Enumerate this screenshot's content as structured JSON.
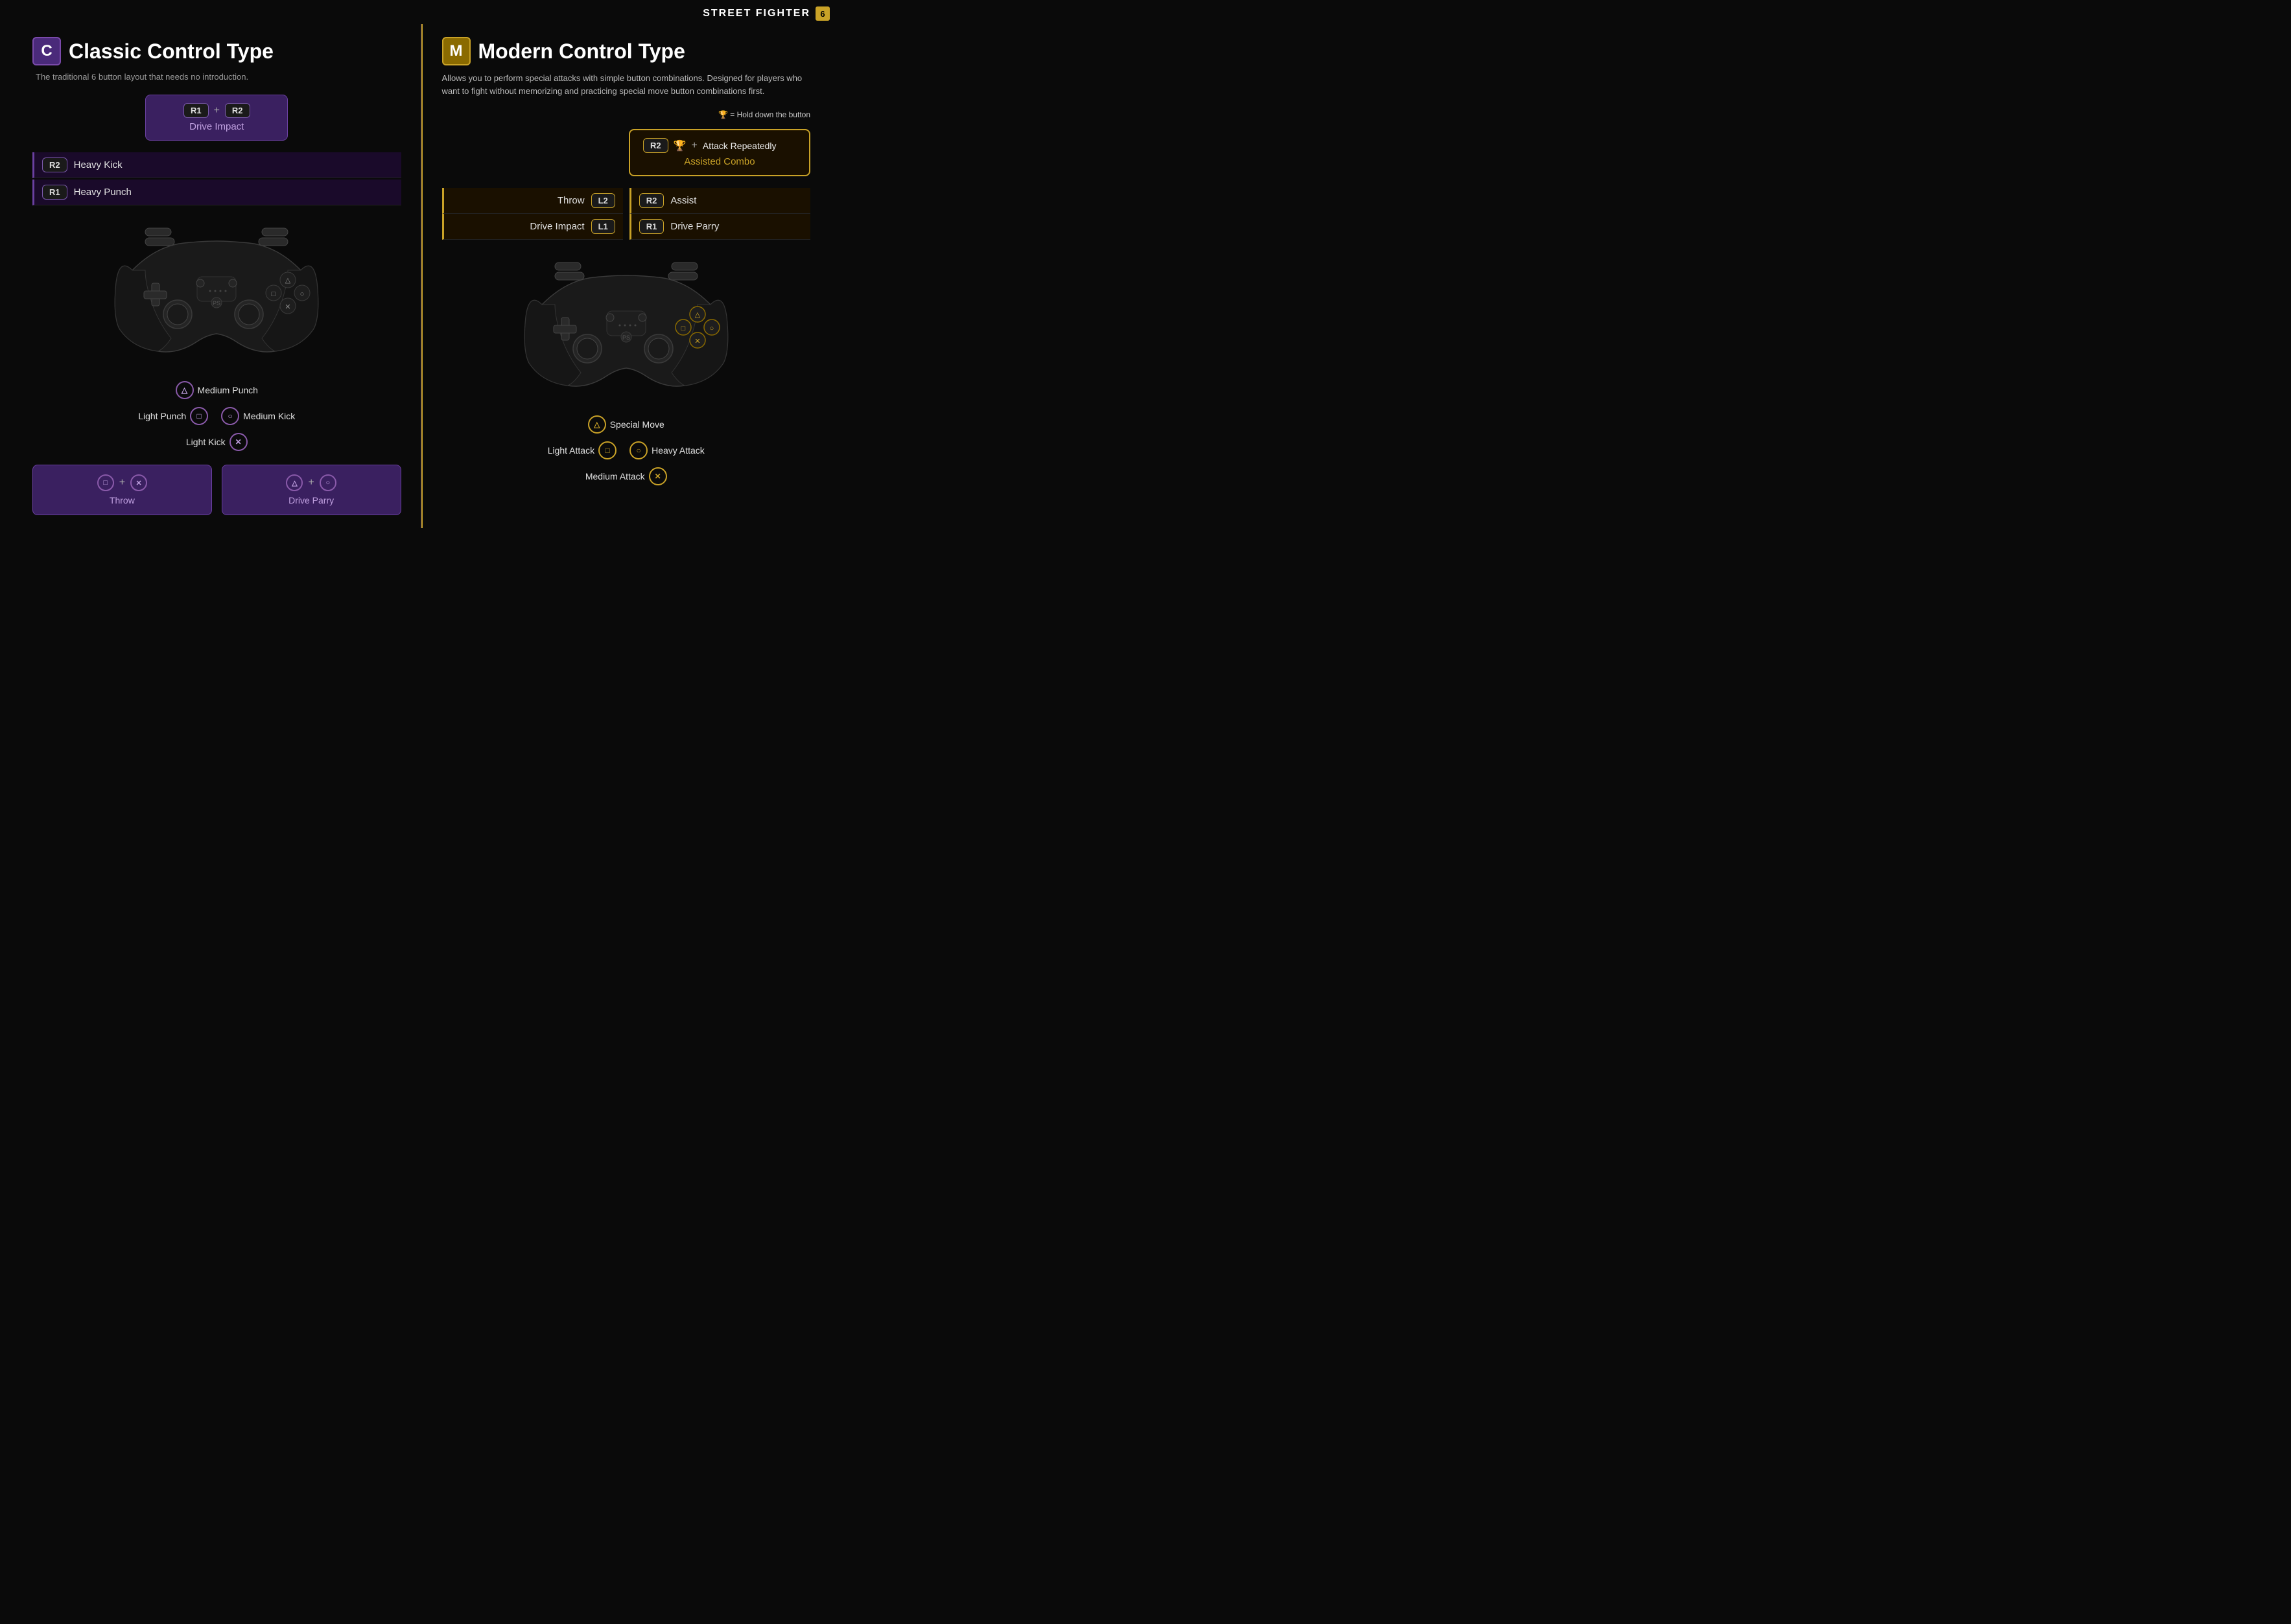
{
  "brand": {
    "name": "STREET FIGHTER",
    "icon": "6"
  },
  "classic": {
    "icon_label": "C",
    "title": "Classic Control Type",
    "subtitle": "The traditional 6 button layout that needs no introduction.",
    "drive_impact": {
      "key1": "R1",
      "key2": "R2",
      "plus": "+",
      "label": "Drive Impact"
    },
    "upper_buttons": [
      {
        "key": "R2",
        "label": "Heavy Kick"
      },
      {
        "key": "R1",
        "label": "Heavy Punch"
      }
    ],
    "face_buttons": [
      {
        "symbol": "△",
        "label": "Medium Punch"
      },
      {
        "symbol": "□",
        "label": "Light Punch"
      },
      {
        "symbol": "○",
        "label": "Medium Kick"
      },
      {
        "symbol": "✕",
        "label": "Light Kick"
      }
    ],
    "combos": [
      {
        "key1": "□",
        "key2": "✕",
        "plus": "+",
        "label": "Throw"
      },
      {
        "key1": "△",
        "key2": "○",
        "plus": "+",
        "label": "Drive Parry"
      }
    ]
  },
  "modern": {
    "icon_label": "M",
    "title": "Modern Control Type",
    "subtitle": "Allows you to perform special attacks with simple button combinations. Designed for players who want to fight without memorizing and practicing special move button combinations first.",
    "hold_note": "🏆 = Hold down the button",
    "assisted_combo": {
      "key": "R2",
      "hold_icon": "🏆",
      "plus": "+",
      "action": "Attack Repeatedly",
      "label": "Assisted Combo"
    },
    "left_buttons": [
      {
        "label": "Throw",
        "key": "L2"
      },
      {
        "label": "Drive Impact",
        "key": "L1"
      }
    ],
    "right_buttons": [
      {
        "key": "R2",
        "label": "Assist"
      },
      {
        "key": "R1",
        "label": "Drive Parry"
      }
    ],
    "face_buttons": [
      {
        "symbol": "△",
        "label": "Special Move"
      },
      {
        "symbol": "□",
        "label": "Light Attack"
      },
      {
        "symbol": "○",
        "label": "Heavy Attack"
      },
      {
        "symbol": "✕",
        "label": "Medium Attack"
      }
    ]
  }
}
